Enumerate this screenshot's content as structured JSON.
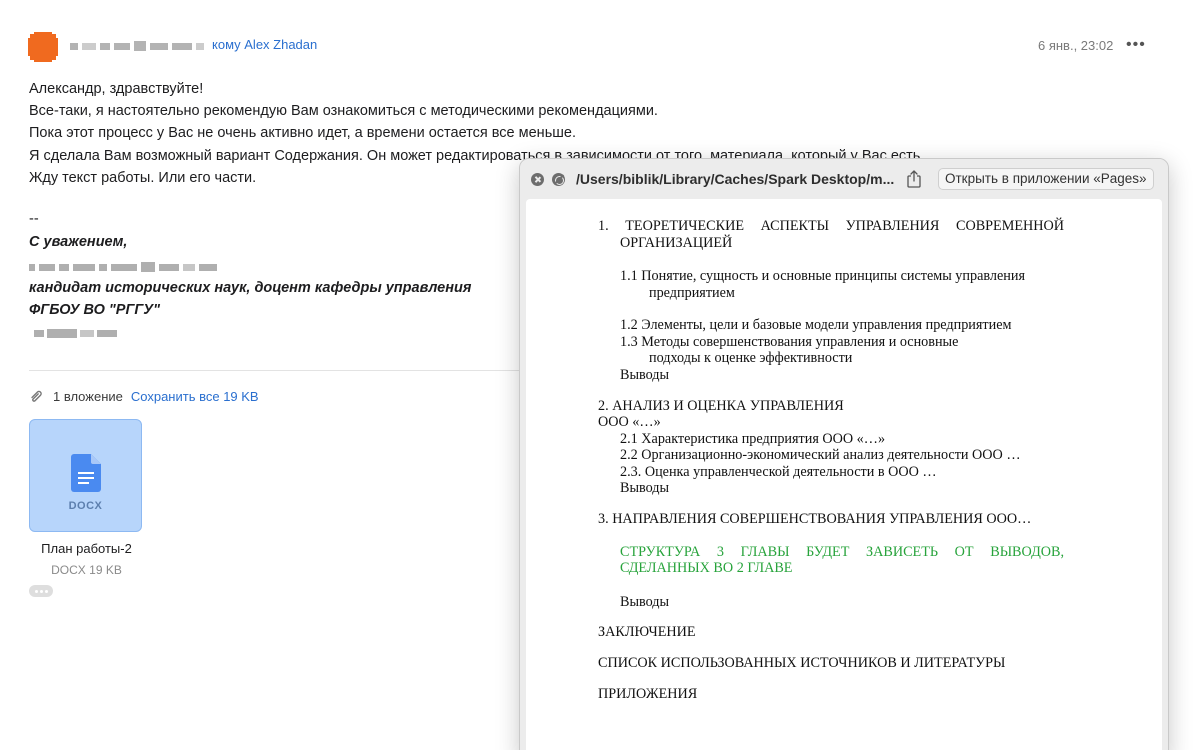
{
  "email": {
    "recipient": "кому Alex Zhadan",
    "date": "6 янв., 23:02",
    "more_label": "•••",
    "body_lines": [
      "Александр, здравствуйте!",
      "Все-таки, я настоятельно рекомендую Вам ознакомиться с методическими рекомендациями.",
      "Пока этот процесс у Вас не очень активно идет, а времени остается все меньше.",
      "Я сделала Вам возможный вариант Содержания. Он может редактироваться в зависимости от того, материала, который у Вас есть.",
      "Жду текст работы. Или его части."
    ],
    "signature": {
      "separator": "--",
      "regards": "С уважением,",
      "title": "кандидат исторических наук, доцент кафедры управления",
      "org": "ФГБОУ ВО \"РГГУ\""
    }
  },
  "attachments": {
    "count_label": "1 вложение",
    "save_all_label": "Сохранить все 19 KB",
    "file": {
      "ext": "DOCX",
      "name": "План работы-2",
      "meta": "DOCX 19 KB"
    }
  },
  "quicklook": {
    "path": "/Users/biblik/Library/Caches/Spark Desktop/m...",
    "open_button": "Открыть в приложении «Pages»",
    "document": {
      "h1_line1": "1.   ТЕОРЕТИЧЕСКИЕ   АСПЕКТЫ   УПРАВЛЕНИЯ   СОВРЕМЕННОЙ",
      "h1_line2": "ОРГАНИЗАЦИЕЙ",
      "s11_line1": "1.1 Понятие, сущность и основные принципы системы управления",
      "s11_line2": "предприятием",
      "s12": "1.2 Элементы, цели и базовые модели управления предприятием",
      "s13_line1": "1.3 Методы совершенствования управления и основные",
      "s13_line2": "подходы к оценке эффективности",
      "conclusions1": "Выводы",
      "h2_line1": "2. АНАЛИЗ И ОЦЕНКА УПРАВЛЕНИЯ",
      "h2_line2": "ООО «…»",
      "s21": "2.1 Характеристика предприятия ООО «…»",
      "s22": "2.2 Организационно-экономический анализ деятельности ООО …",
      "s23": "2.3. Оценка управленческой деятельности в ООО …",
      "conclusions2": "Выводы",
      "h3": "3. НАПРАВЛЕНИЯ СОВЕРШЕНСТВОВАНИЯ УПРАВЛЕНИЯ ООО…",
      "note_line1": "СТРУКТУРА   3   ГЛАВЫ   БУДЕТ   ЗАВИСЕТЬ   ОТ   ВЫВОДОВ,",
      "note_line2": "СДЕЛАННЫХ ВО 2 ГЛАВЕ",
      "conclusions3": "Выводы",
      "conclusion": "ЗАКЛЮЧЕНИЕ",
      "references": "СПИСОК ИСПОЛЬЗОВАННЫХ ИСТОЧНИКОВ И ЛИТЕРАТУРЫ",
      "appendices": "ПРИЛОЖЕНИЯ"
    }
  },
  "colors": {
    "link": "#2a6fcf",
    "avatar": "#f06a1f",
    "attachment_bg": "#b7d5fb",
    "note_green": "#27a33b"
  },
  "icons": [
    "avatar-icon",
    "more-icon",
    "paperclip-icon",
    "docx-file-icon",
    "close-icon",
    "fullscreen-icon",
    "share-icon"
  ]
}
